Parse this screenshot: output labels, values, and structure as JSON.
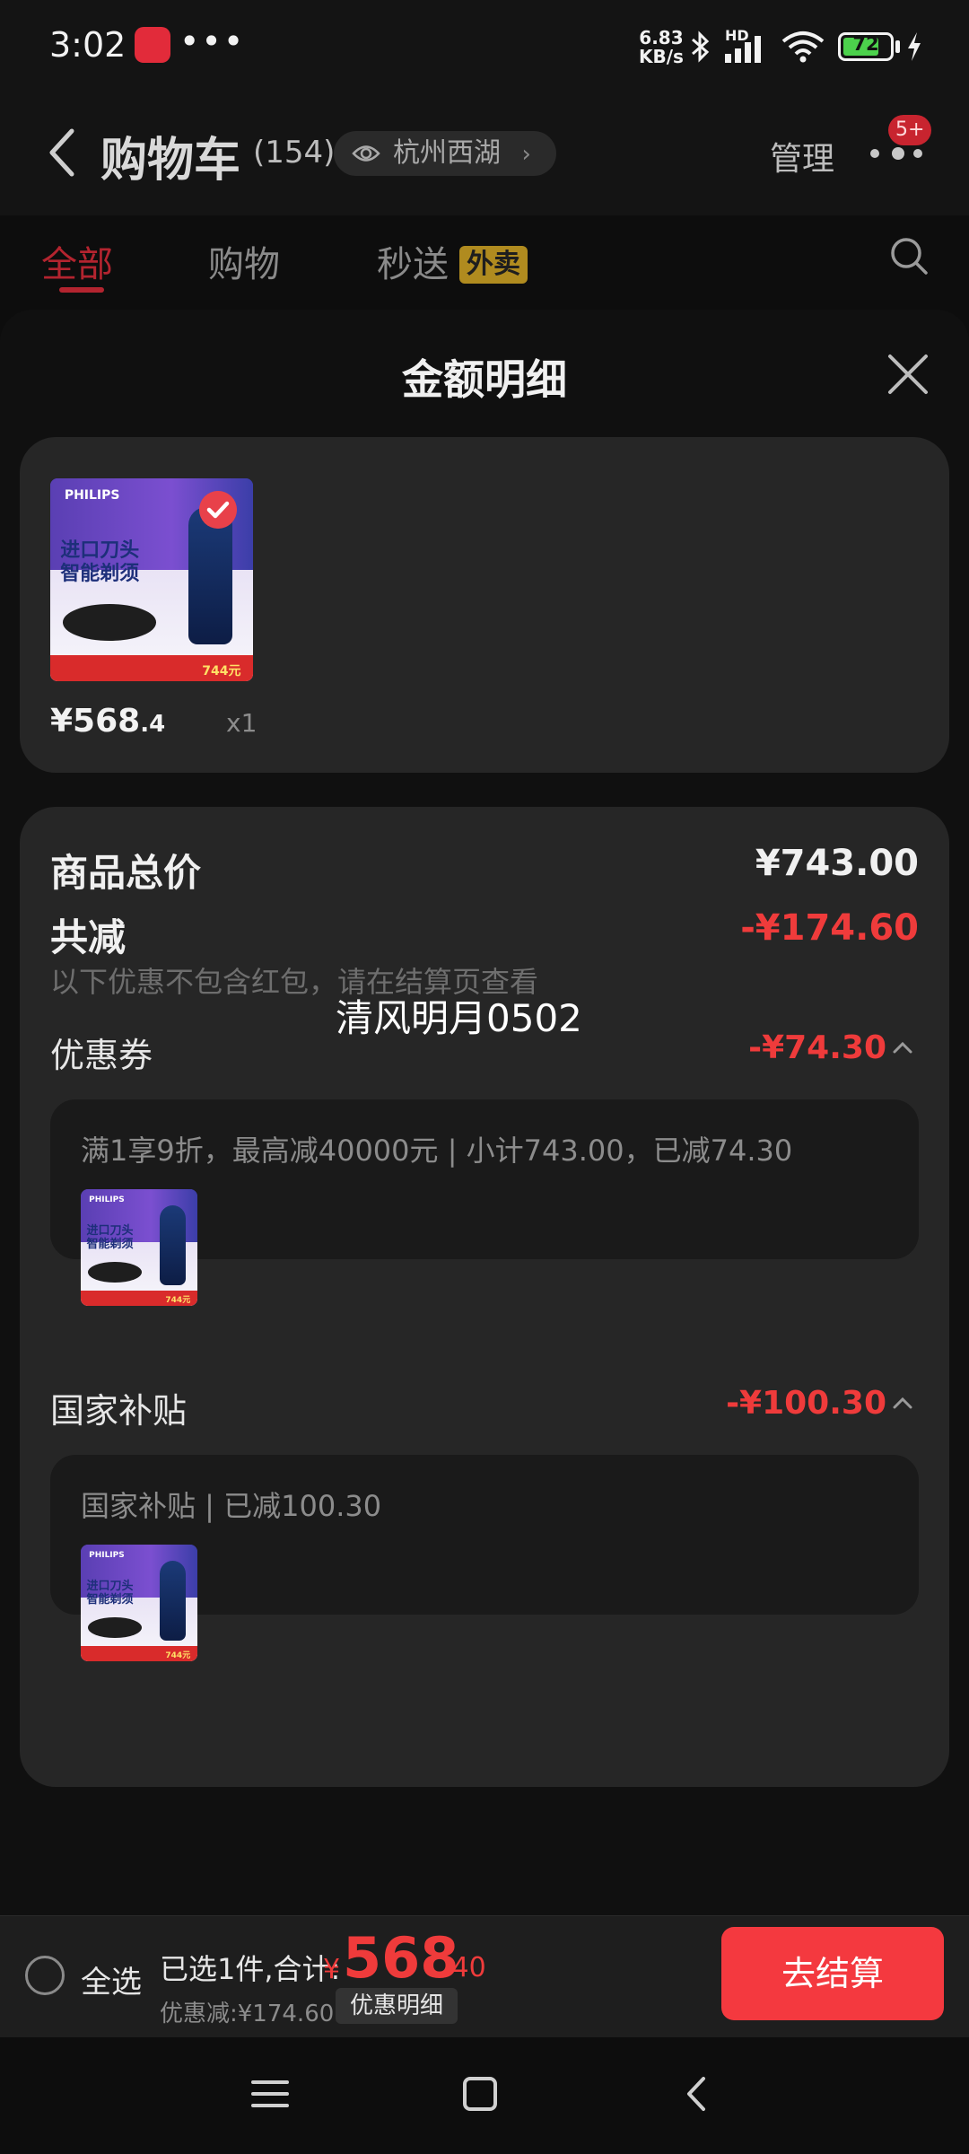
{
  "status_bar": {
    "time": "3:02",
    "dots": "•••",
    "speed_value": "6.83",
    "speed_unit": "KB/s",
    "network": "HD",
    "battery": "72"
  },
  "header": {
    "title": "购物车",
    "count": "(154)",
    "location": "杭州西湖",
    "manage": "管理",
    "more_badge": "5+"
  },
  "tabs": [
    {
      "label": "全部",
      "active": true
    },
    {
      "label": "购物"
    },
    {
      "label": "秒送",
      "tag": "外卖"
    }
  ],
  "sheet": {
    "title": "金额明细",
    "product": {
      "price_int": "¥568",
      "price_dec": ".4",
      "qty": "x1",
      "thumb": {
        "brand": "PHILIPS",
        "line1": "进口刀头",
        "line2": "智能剃须",
        "strip": "744元"
      }
    },
    "detail": {
      "total_label": "商品总价",
      "total_value": "¥743.00",
      "reduction_label": "共减",
      "reduction_value": "-¥174.60",
      "note": "以下优惠不包含红包，请在结算页查看",
      "watermark": "清风明月0502",
      "coupon": {
        "label": "优惠券",
        "value": "-¥74.30",
        "desc": "满1享9折，最高减40000元 | 小计743.00，已减74.30"
      },
      "subsidy": {
        "label": "国家补贴",
        "value": "-¥100.30",
        "desc": "国家补贴 | 已减100.30"
      }
    }
  },
  "bottom_bar": {
    "select_all": "全选",
    "summary": "已选1件,合计:",
    "currency": "¥",
    "total_int": "568",
    "total_dec": ".40",
    "discount": "优惠减:¥174.60",
    "discount_detail": "优惠明细",
    "checkout": "去结算"
  },
  "colors": {
    "accent_red": "#ef3b3b",
    "checkout_button": "#f4393f",
    "tab_active": "#b3242f",
    "waimai_tag": "#b08b1f"
  }
}
